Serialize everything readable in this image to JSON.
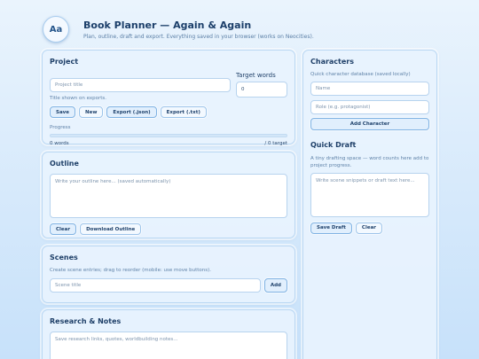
{
  "header": {
    "logo_text": "Aa",
    "title": "Book Planner — Again & Again",
    "subtitle": "Plan, outline, draft and export. Everything saved in your browser (works on Neocities)."
  },
  "project": {
    "heading": "Project",
    "title_placeholder": "Project title",
    "target_label": "Target words",
    "target_value": "0",
    "title_hint": "Title shown on exports.",
    "buttons": {
      "save": "Save",
      "new": "New",
      "export_json": "Export (.json)",
      "export_txt": "Export (.txt)"
    },
    "progress_label": "Progress",
    "progress_fraction": 0,
    "words_text": "0 words",
    "target_text": "/ 0 target"
  },
  "outline": {
    "heading": "Outline",
    "placeholder": "Write your outline here... (saved automatically)",
    "buttons": {
      "clear": "Clear",
      "download": "Download Outline"
    }
  },
  "scenes": {
    "heading": "Scenes",
    "hint": "Create scene entries; drag to reorder (mobile: use move buttons).",
    "title_placeholder": "Scene title",
    "add_label": "Add"
  },
  "research": {
    "heading": "Research & Notes",
    "placeholder": "Save research links, quotes, worldbuilding notes..."
  },
  "characters": {
    "heading": "Characters",
    "hint": "Quick character database (saved locally)",
    "name_placeholder": "Name",
    "role_placeholder": "Role (e.g. protagonist)",
    "add_label": "Add Character"
  },
  "quick_draft": {
    "heading": "Quick Draft",
    "hint": "A tiny drafting space — word counts here add to project progress.",
    "placeholder": "Write scene snippets or draft text here...",
    "buttons": {
      "save": "Save Draft",
      "clear": "Clear"
    }
  },
  "colors": {
    "accent": "#4f92d6",
    "card_bg": "#e8f3fe",
    "border": "#b9d7f3"
  }
}
